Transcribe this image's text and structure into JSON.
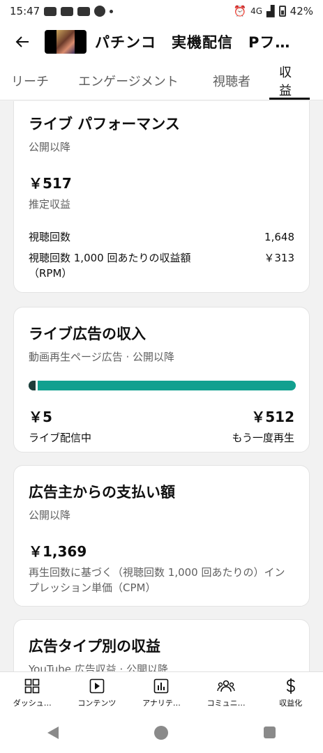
{
  "status_bar": {
    "time": "15:47",
    "network": "4G",
    "battery": "42%"
  },
  "header": {
    "title": "パチンコ　実機配信　Pフ…"
  },
  "tabs": [
    {
      "label": "リーチ",
      "active": false
    },
    {
      "label": "エンゲージメント",
      "active": false
    },
    {
      "label": "視聴者",
      "active": false
    },
    {
      "label": "収益",
      "active": true
    }
  ],
  "live_performance": {
    "title": "ライブ パフォーマンス",
    "subtitle": "公開以降",
    "estimated_revenue": "￥517",
    "estimated_revenue_label": "推定収益",
    "views_label": "視聴回数",
    "views_value": "1,648",
    "rpm_label": "視聴回数 1,000 回あたりの収益額（RPM）",
    "rpm_value": "￥313"
  },
  "live_ad_revenue": {
    "title": "ライブ広告の収入",
    "subtitle": "動画再生ページ広告 · 公開以降",
    "live_value": "￥5",
    "live_label": "ライブ配信中",
    "replay_value": "￥512",
    "replay_label": "もう一度再生",
    "live_share": 0.0097,
    "colors": {
      "live": "#1f3d3a",
      "replay": "#11a08f"
    }
  },
  "advertiser_payment": {
    "title": "広告主からの支払い額",
    "subtitle": "公開以降",
    "value": "￥1,369",
    "description": "再生回数に基づく（視聴回数 1,000 回あたりの）インプレッション単価（CPM）"
  },
  "ad_type_revenue": {
    "title": "広告タイプ別の収益",
    "subtitle": "YouTube 広告収益 · 公開以降"
  },
  "bottom_nav": [
    {
      "label": "ダッシュ…",
      "icon": "dashboard-icon"
    },
    {
      "label": "コンテンツ",
      "icon": "content-icon"
    },
    {
      "label": "アナリテ…",
      "icon": "analytics-icon"
    },
    {
      "label": "コミュニ…",
      "icon": "community-icon"
    },
    {
      "label": "収益化",
      "icon": "dollar-icon"
    }
  ]
}
